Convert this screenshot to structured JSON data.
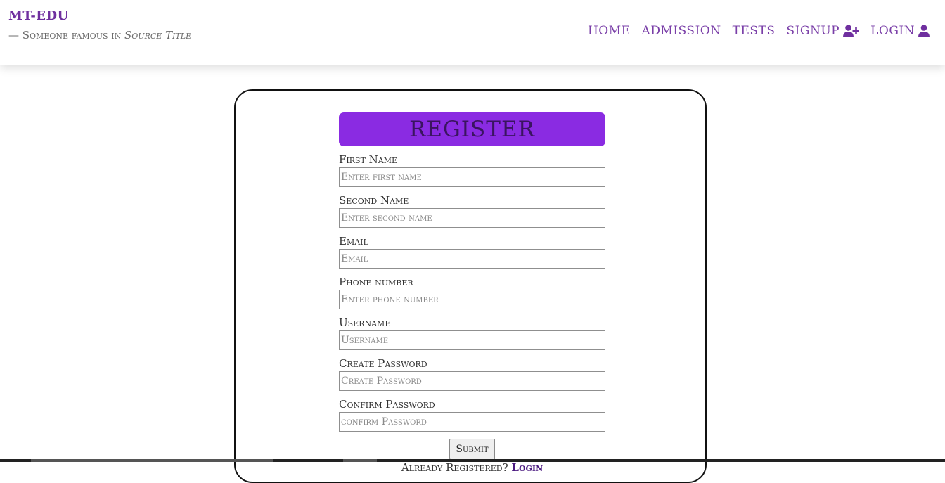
{
  "header": {
    "brand": "MT-EDU",
    "tagline_prefix": "— Someone famous in ",
    "tagline_source": "Source Title"
  },
  "nav": {
    "home": "HOME",
    "admission": "ADMISSION",
    "tests": "TESTS",
    "signup": "SIGNUP",
    "login": "LOGIN"
  },
  "form": {
    "title": "REGISTER",
    "fields": [
      {
        "label": "First Name",
        "placeholder": "Enter first name"
      },
      {
        "label": "Second Name",
        "placeholder": "Enter second name"
      },
      {
        "label": "Email",
        "placeholder": "Email"
      },
      {
        "label": "Phone number",
        "placeholder": "Enter phone number"
      },
      {
        "label": "Username",
        "placeholder": "Username"
      },
      {
        "label": "Create Password",
        "placeholder": "Create Password"
      },
      {
        "label": "Confirm Password",
        "placeholder": "confirm Password"
      }
    ],
    "submit_label": "Submit",
    "already_text": "Already Registered?",
    "login_link": "Login"
  },
  "colors": {
    "accent": "#8a2be2",
    "nav": "#7a3fa8",
    "brand": "#6f2f9f"
  },
  "icons": {
    "signup": "user-plus-icon",
    "login": "user-icon"
  }
}
